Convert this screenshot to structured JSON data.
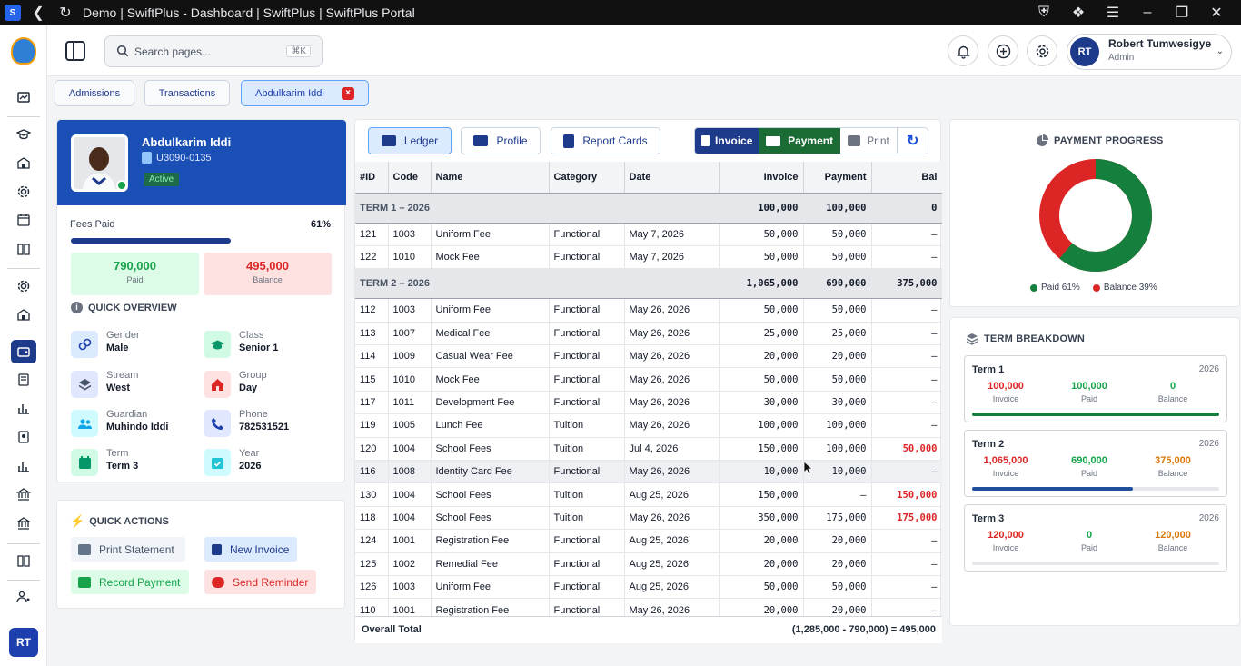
{
  "browser": {
    "title": "Demo | SwiftPlus - Dashboard | SwiftPlus | SwiftPlus Portal",
    "back_icon": "back-icon",
    "reload_icon": "reload-icon"
  },
  "header": {
    "search_placeholder": "Search pages...",
    "search_shortcut": "⌘K",
    "user": {
      "initials": "RT",
      "name": "Robert Tumwesigye",
      "role": "Admin"
    }
  },
  "rail": {
    "avatar_initials": "RT"
  },
  "tabs": [
    {
      "label": "Admissions"
    },
    {
      "label": "Transactions"
    },
    {
      "label": "Abdulkarim Iddi",
      "active": true,
      "close": "×"
    }
  ],
  "student": {
    "name": "Abdulkarim Iddi",
    "id": "U3090-0135",
    "status": "Active",
    "fees_label": "Fees Paid",
    "fees_pct": "61%",
    "fees_progress": 0.61,
    "paid_value": "790,000",
    "paid_label": "Paid",
    "balance_value": "495,000",
    "balance_label": "Balance"
  },
  "overview": {
    "title": "QUICK OVERVIEW",
    "items": [
      {
        "label": "Gender",
        "value": "Male",
        "icon": "gender-icon"
      },
      {
        "label": "Class",
        "value": "Senior 1",
        "icon": "graduation-cap-icon"
      },
      {
        "label": "Stream",
        "value": "West",
        "icon": "layers-icon"
      },
      {
        "label": "Group",
        "value": "Day",
        "icon": "house-icon"
      },
      {
        "label": "Guardian",
        "value": "Muhindo Iddi",
        "icon": "users-icon"
      },
      {
        "label": "Phone",
        "value": "782531521",
        "icon": "phone-icon"
      },
      {
        "label": "Term",
        "value": "Term 3",
        "icon": "calendar-icon"
      },
      {
        "label": "Year",
        "value": "2026",
        "icon": "calendar-check-icon"
      }
    ]
  },
  "quick_actions": {
    "title": "QUICK ACTIONS",
    "print_statement": "Print Statement",
    "new_invoice": "New Invoice",
    "record_payment": "Record Payment",
    "send_reminder": "Send Reminder"
  },
  "ledger": {
    "tabs": {
      "ledger": "Ledger",
      "profile": "Profile",
      "report_cards": "Report Cards"
    },
    "actions": {
      "invoice": "Invoice",
      "payment": "Payment",
      "print": "Print"
    },
    "columns": [
      "#ID",
      "Code",
      "Name",
      "Category",
      "Date",
      "Invoice",
      "Payment",
      "Bal"
    ],
    "term1": {
      "label": "TERM 1 – 2026",
      "invoice": "100,000",
      "payment": "100,000",
      "balance": "0"
    },
    "term2": {
      "label": "TERM 2 – 2026",
      "invoice": "1,065,000",
      "payment": "690,000",
      "balance": "375,000"
    },
    "term1_rows": [
      [
        "121",
        "1003",
        "Uniform Fee",
        "Functional",
        "May 7, 2026",
        "50,000",
        "50,000",
        "–"
      ],
      [
        "122",
        "1010",
        "Mock Fee",
        "Functional",
        "May 7, 2026",
        "50,000",
        "50,000",
        "–"
      ]
    ],
    "term2_rows": [
      [
        "112",
        "1003",
        "Uniform Fee",
        "Functional",
        "May 26, 2026",
        "50,000",
        "50,000",
        "–"
      ],
      [
        "113",
        "1007",
        "Medical Fee",
        "Functional",
        "May 26, 2026",
        "25,000",
        "25,000",
        "–"
      ],
      [
        "114",
        "1009",
        "Casual Wear Fee",
        "Functional",
        "May 26, 2026",
        "20,000",
        "20,000",
        "–"
      ],
      [
        "115",
        "1010",
        "Mock Fee",
        "Functional",
        "May 26, 2026",
        "50,000",
        "50,000",
        "–"
      ],
      [
        "117",
        "1011",
        "Development Fee",
        "Functional",
        "May 26, 2026",
        "30,000",
        "30,000",
        "–"
      ],
      [
        "119",
        "1005",
        "Lunch Fee",
        "Tuition",
        "May 26, 2026",
        "100,000",
        "100,000",
        "–"
      ],
      [
        "120",
        "1004",
        "School Fees",
        "Tuition",
        "Jul 4, 2026",
        "150,000",
        "100,000",
        "50,000"
      ],
      [
        "116",
        "1008",
        "Identity Card Fee",
        "Functional",
        "May 26, 2026",
        "10,000",
        "10,000",
        "–"
      ],
      [
        "130",
        "1004",
        "School Fees",
        "Tuition",
        "Aug 25, 2026",
        "150,000",
        "–",
        "150,000"
      ],
      [
        "118",
        "1004",
        "School Fees",
        "Tuition",
        "May 26, 2026",
        "350,000",
        "175,000",
        "175,000"
      ],
      [
        "124",
        "1001",
        "Registration Fee",
        "Functional",
        "Aug 25, 2026",
        "20,000",
        "20,000",
        "–"
      ],
      [
        "125",
        "1002",
        "Remedial Fee",
        "Functional",
        "Aug 25, 2026",
        "20,000",
        "20,000",
        "–"
      ],
      [
        "126",
        "1003",
        "Uniform Fee",
        "Functional",
        "Aug 25, 2026",
        "50,000",
        "50,000",
        "–"
      ],
      [
        "110",
        "1001",
        "Registration Fee",
        "Functional",
        "May 26, 2026",
        "20,000",
        "20,000",
        "–"
      ]
    ],
    "footer_label": "Overall Total",
    "footer_value": "(1,285,000 - 790,000) = 495,000"
  },
  "payment_progress": {
    "title": "PAYMENT PROGRESS",
    "paid_legend": "Paid 61%",
    "balance_legend": "Balance 39%",
    "paid_fraction": 0.61,
    "paid_color": "#15803d",
    "balance_color": "#dc2626"
  },
  "term_breakdown": {
    "title": "TERM BREAKDOWN",
    "terms": [
      {
        "name": "Term 1",
        "year": "2026",
        "invoice": "100,000",
        "paid": "100,000",
        "balance": "0",
        "invoice_label": "Invoice",
        "paid_label": "Paid",
        "balance_label": "Balance",
        "progress": 1.0,
        "color": "#15803d"
      },
      {
        "name": "Term 2",
        "year": "2026",
        "invoice": "1,065,000",
        "paid": "690,000",
        "balance": "375,000",
        "invoice_label": "Invoice",
        "paid_label": "Paid",
        "balance_label": "Balance",
        "progress": 0.65,
        "color": "#1e4f9c"
      },
      {
        "name": "Term 3",
        "year": "2026",
        "invoice": "120,000",
        "paid": "0",
        "balance": "120,000",
        "invoice_label": "Invoice",
        "paid_label": "Paid",
        "balance_label": "Balance",
        "progress": 0,
        "color": "#1e4f9c"
      }
    ]
  }
}
